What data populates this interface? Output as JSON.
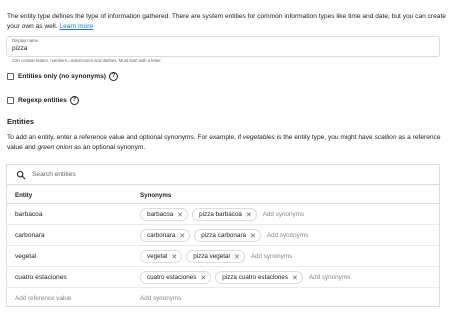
{
  "intro": {
    "text": "The entity type defines the type of information gathered. There are system entities for common information types like time and date, but you can create your own as well.",
    "link": "Learn more"
  },
  "display_name": {
    "label": "Display name",
    "value": "pizza",
    "hint": "Can contain letters, numbers, underscores and dashes. Must start with a letter."
  },
  "entities_only": {
    "label": "Entities only (no synonyms)",
    "checked": false
  },
  "regexp": {
    "label": "Regexp entities",
    "checked": false
  },
  "entities_section": {
    "title": "Entities",
    "desc_part1": "To add an entity, enter a reference value and optional synonyms. For example, if ",
    "desc_em1": "vegetables",
    "desc_part2": " is the entity type, you might have ",
    "desc_em2": "scallion",
    "desc_part3": " as a reference value and ",
    "desc_em3": "green onion",
    "desc_part4": " as an optional synonym."
  },
  "table": {
    "search_placeholder": "Search entities",
    "col_entity": "Entity",
    "col_synonyms": "Synonyms",
    "add_synonyms": "Add synonyms",
    "rows": [
      {
        "entity": "barbacoa",
        "synonyms": [
          "barbacoa",
          "pizza barbacoa"
        ]
      },
      {
        "entity": "carbonara",
        "synonyms": [
          "carbonara",
          "pizza carbonara"
        ]
      },
      {
        "entity": "vegetal",
        "synonyms": [
          "vegetal",
          "pizza vegetal"
        ]
      },
      {
        "entity": "cuatro estaciones",
        "synonyms": [
          "cuatro estaciones",
          "pizza cuatro estaciones"
        ]
      }
    ],
    "add_reference_placeholder": "Add reference value",
    "add_synonyms_placeholder": "Add synonyms"
  },
  "colors": {
    "link": "#1a73e8",
    "border": "#dadce0",
    "muted": "#5f6368"
  },
  "icons": {
    "search": "search-icon",
    "help": "help-circle-icon",
    "remove": "close-icon"
  }
}
